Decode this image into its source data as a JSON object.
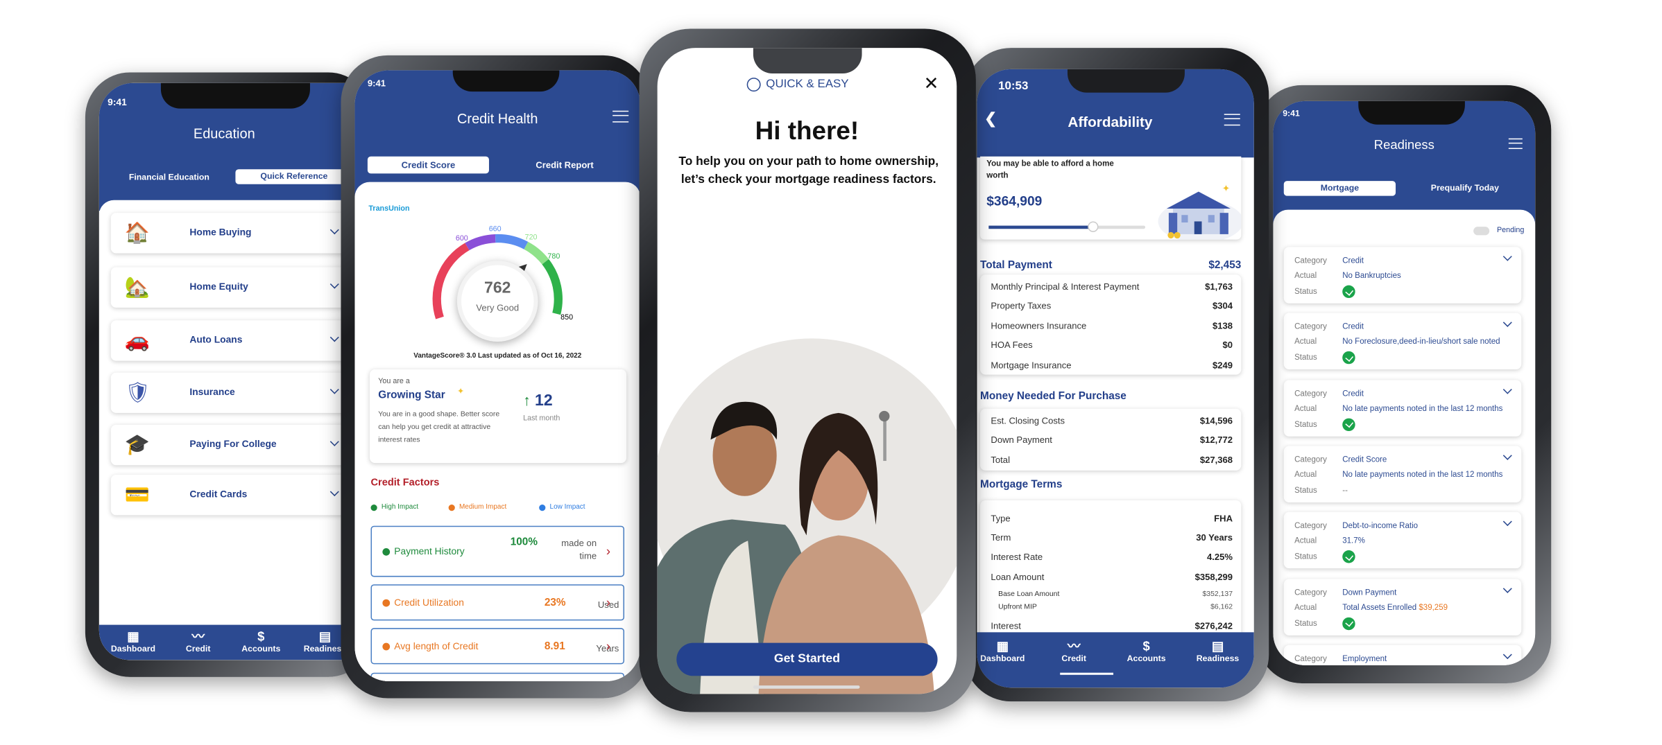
{
  "colors": {
    "brand_blue": "#2c4a91",
    "high_impact": "#1e8a3c",
    "medium_impact": "#e87722",
    "low_impact": "#2f7de1",
    "credit_factors_title": "#b3202a",
    "status_ok": "#1aa34a"
  },
  "education": {
    "status_time": "9:41",
    "title": "Education",
    "tabs": [
      {
        "label": "Financial Education",
        "active": false
      },
      {
        "label": "Quick Reference",
        "active": true
      }
    ],
    "items": [
      {
        "label": "Home Buying",
        "icon": "house-icon"
      },
      {
        "label": "Home Equity",
        "icon": "house-coin-icon"
      },
      {
        "label": "Auto Loans",
        "icon": "car-icon"
      },
      {
        "label": "Insurance",
        "icon": "shield-hands-icon"
      },
      {
        "label": "Paying For College",
        "icon": "graduation-cap-icon"
      },
      {
        "label": "Credit Cards",
        "icon": "credit-cards-icon"
      }
    ],
    "nav": [
      {
        "label": "Dashboard",
        "icon": "grid-icon"
      },
      {
        "label": "Credit",
        "icon": "trend-icon"
      },
      {
        "label": "Accounts",
        "icon": "dollar-cycle-icon"
      },
      {
        "label": "Readiness",
        "icon": "document-icon"
      }
    ]
  },
  "credit": {
    "status_time": "9:41",
    "title": "Credit Health",
    "tabs": [
      {
        "label": "Credit Score",
        "active": true
      },
      {
        "label": "Credit Report",
        "active": false
      }
    ],
    "bureau": "TransUnion",
    "gauge": {
      "ticks": [
        "600",
        "660",
        "720",
        "780",
        "850"
      ],
      "score": "762",
      "rating": "Very Good",
      "segment_colors": [
        "#e8415a",
        "#8a4fd8",
        "#5b8df0",
        "#8fe28a",
        "#2fb24a"
      ]
    },
    "updated": "VantageScore® 3.0 Last updated as of Oct 16, 2022",
    "star": {
      "prefix": "You are a",
      "title": "Growing Star",
      "desc": "You are in a good shape. Better score can help you get credit at attractive interest rates",
      "change": "12",
      "change_label": "Last month"
    },
    "factors_title": "Credit Factors",
    "legend": [
      {
        "label": "High Impact",
        "color": "#1e8a3c"
      },
      {
        "label": "Medium Impact",
        "color": "#e87722"
      },
      {
        "label": "Low Impact",
        "color": "#2f7de1"
      }
    ],
    "factors": [
      {
        "label": "Payment History",
        "value": "100%",
        "unit": "made on time",
        "color": "#1e8a3c"
      },
      {
        "label": "Credit Utilization",
        "value": "23%",
        "unit": "Used",
        "color": "#e87722"
      },
      {
        "label": "Avg length of Credit",
        "value": "8.91",
        "unit": "Years",
        "color": "#e87722"
      }
    ]
  },
  "welcome": {
    "badge": "QUICK & EASY",
    "heading": "Hi there!",
    "text": "To help you on your path to home ownership, let’s check your mortgage readiness factors.",
    "cta": "Get Started"
  },
  "afford": {
    "status_time": "10:53",
    "title": "Affordability",
    "intro": "You may be able to afford a home worth",
    "amount": "$364,909",
    "slider_percent": 67,
    "total_payment": {
      "label": "Total Payment",
      "value": "$2,453",
      "rows": [
        {
          "label": "Monthly Principal & Interest Payment",
          "value": "$1,763"
        },
        {
          "label": "Property Taxes",
          "value": "$304"
        },
        {
          "label": "Homeowners Insurance",
          "value": "$138"
        },
        {
          "label": "HOA Fees",
          "value": "$0"
        },
        {
          "label": "Mortgage Insurance",
          "value": "$249"
        }
      ]
    },
    "money_needed": {
      "label": "Money Needed For Purchase",
      "rows": [
        {
          "label": "Est. Closing Costs",
          "value": "$14,596"
        },
        {
          "label": "Down Payment",
          "value": "$12,772"
        },
        {
          "label": "Total",
          "value": "$27,368"
        }
      ]
    },
    "terms": {
      "label": "Mortgage Terms",
      "rows": [
        {
          "label": "Type",
          "value": "FHA"
        },
        {
          "label": "Term",
          "value": "30  Years"
        },
        {
          "label": "Interest Rate",
          "value": "4.25%"
        },
        {
          "label": "Loan Amount",
          "value": "$358,299"
        }
      ],
      "sub_rows": [
        {
          "label": "Base Loan Amount",
          "value": "$352,137"
        },
        {
          "label": "Upfront MIP",
          "value": "$6,162"
        }
      ],
      "interest": {
        "label": "Interest",
        "value": "$276,242"
      }
    },
    "nav": [
      {
        "label": "Dashboard",
        "icon": "grid-icon"
      },
      {
        "label": "Credit",
        "icon": "trend-icon",
        "active": true
      },
      {
        "label": "Accounts",
        "icon": "dollar-cycle-icon"
      },
      {
        "label": "Readiness",
        "icon": "document-icon"
      }
    ]
  },
  "readiness": {
    "status_time": "9:41",
    "title": "Readiness",
    "tabs": [
      {
        "label": "Mortgage",
        "active": true
      },
      {
        "label": "Prequalify Today",
        "active": false
      }
    ],
    "toggle_label": "Pending",
    "labels": {
      "category": "Category",
      "actual": "Actual",
      "status": "Status"
    },
    "items": [
      {
        "category": "Credit",
        "actual": "No Bankruptcies",
        "status": "ok"
      },
      {
        "category": "Credit",
        "actual": "No Foreclosure,deed-in-lieu/short sale noted",
        "status": "ok"
      },
      {
        "category": "Credit",
        "actual": "No late payments noted in the last 12 months",
        "status": "ok"
      },
      {
        "category": "Credit Score",
        "actual": "No late payments noted in the last 12 months",
        "status": "--"
      },
      {
        "category": "Debt-to-income Ratio",
        "actual": "31.7%",
        "status": "ok"
      },
      {
        "category": "Down Payment",
        "actual": "Total Assets Enrolled",
        "actual_highlight": "$39,259",
        "status": "ok"
      },
      {
        "category": "Employment"
      }
    ]
  }
}
